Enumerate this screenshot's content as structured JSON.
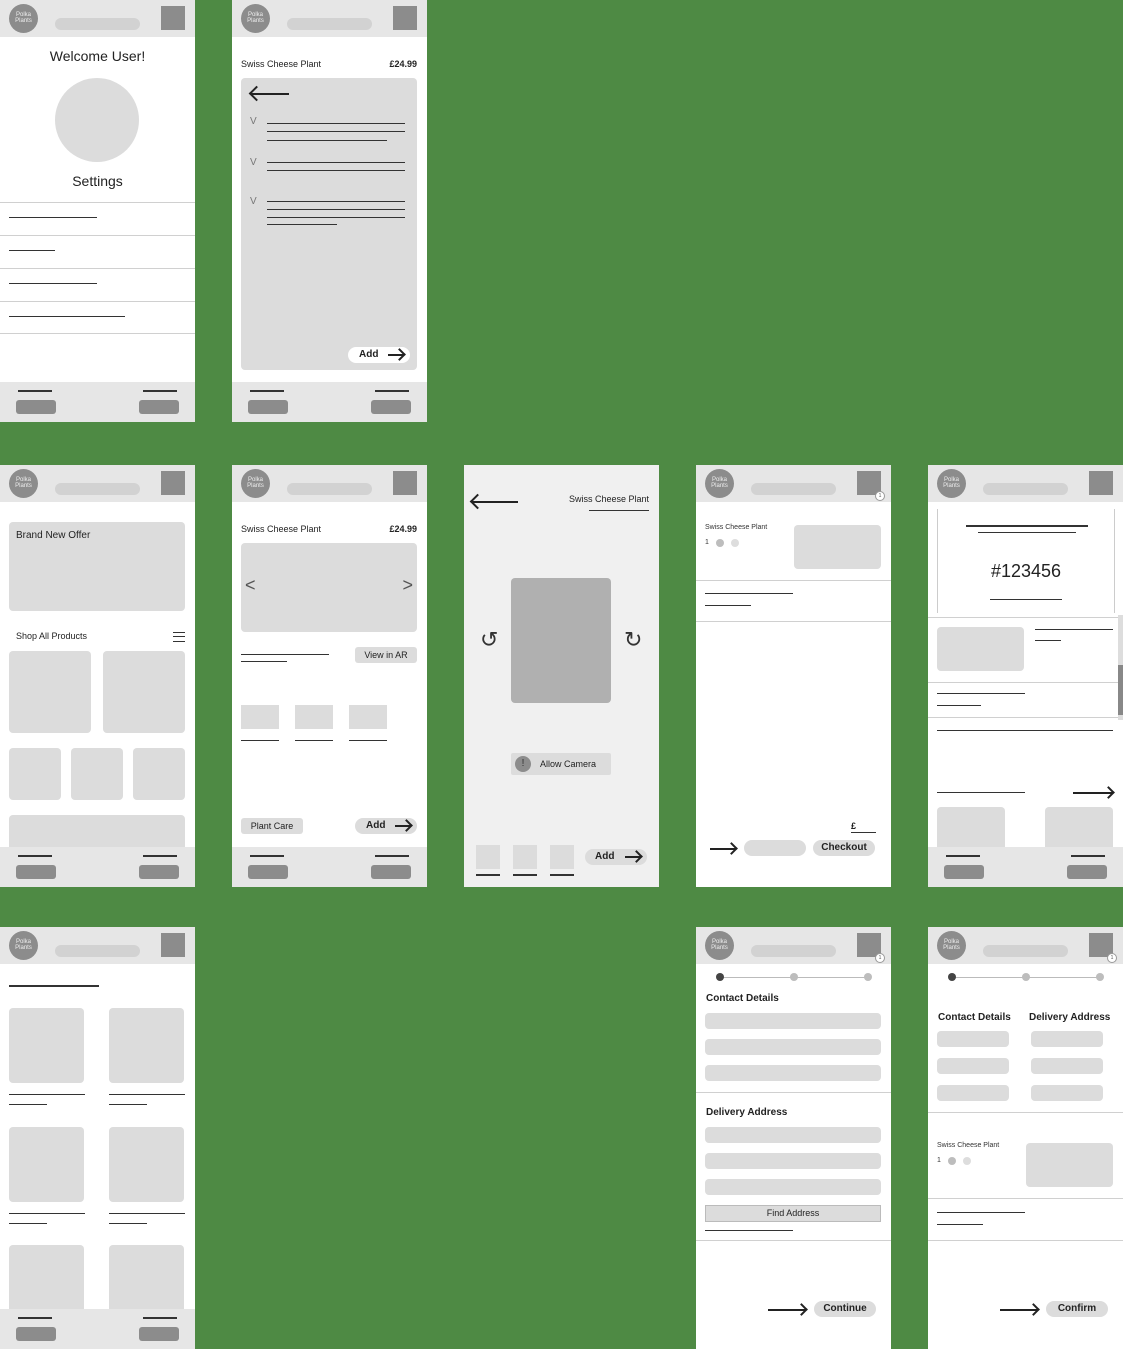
{
  "logo_text": "Polka Plants",
  "cart_count": "1",
  "settings": {
    "welcome": "Welcome User!",
    "title": "Settings"
  },
  "care": {
    "product": "Swiss Cheese Plant",
    "price": "£24.99",
    "add": "Add"
  },
  "home": {
    "offer": "Brand New Offer",
    "shop_all": "Shop All Products"
  },
  "product": {
    "name": "Swiss Cheese Plant",
    "price": "£24.99",
    "view_ar": "View in AR",
    "plant_care": "Plant Care",
    "add": "Add",
    "prev": "<",
    "next": ">"
  },
  "ar": {
    "title": "Swiss Cheese Plant",
    "allow_camera": "Allow Camera",
    "add": "Add"
  },
  "cart": {
    "item": "Swiss Cheese Plant",
    "qty": "1",
    "currency": "£",
    "checkout": "Checkout"
  },
  "confirmation": {
    "order_number": "#123456"
  },
  "checkout": {
    "contact": "Contact Details",
    "delivery": "Delivery Address",
    "find": "Find Address",
    "continue": "Continue"
  },
  "confirm": {
    "contact": "Contact Details",
    "delivery": "Delivery Address",
    "item": "Swiss Cheese Plant",
    "qty": "1",
    "confirm": "Confirm"
  }
}
